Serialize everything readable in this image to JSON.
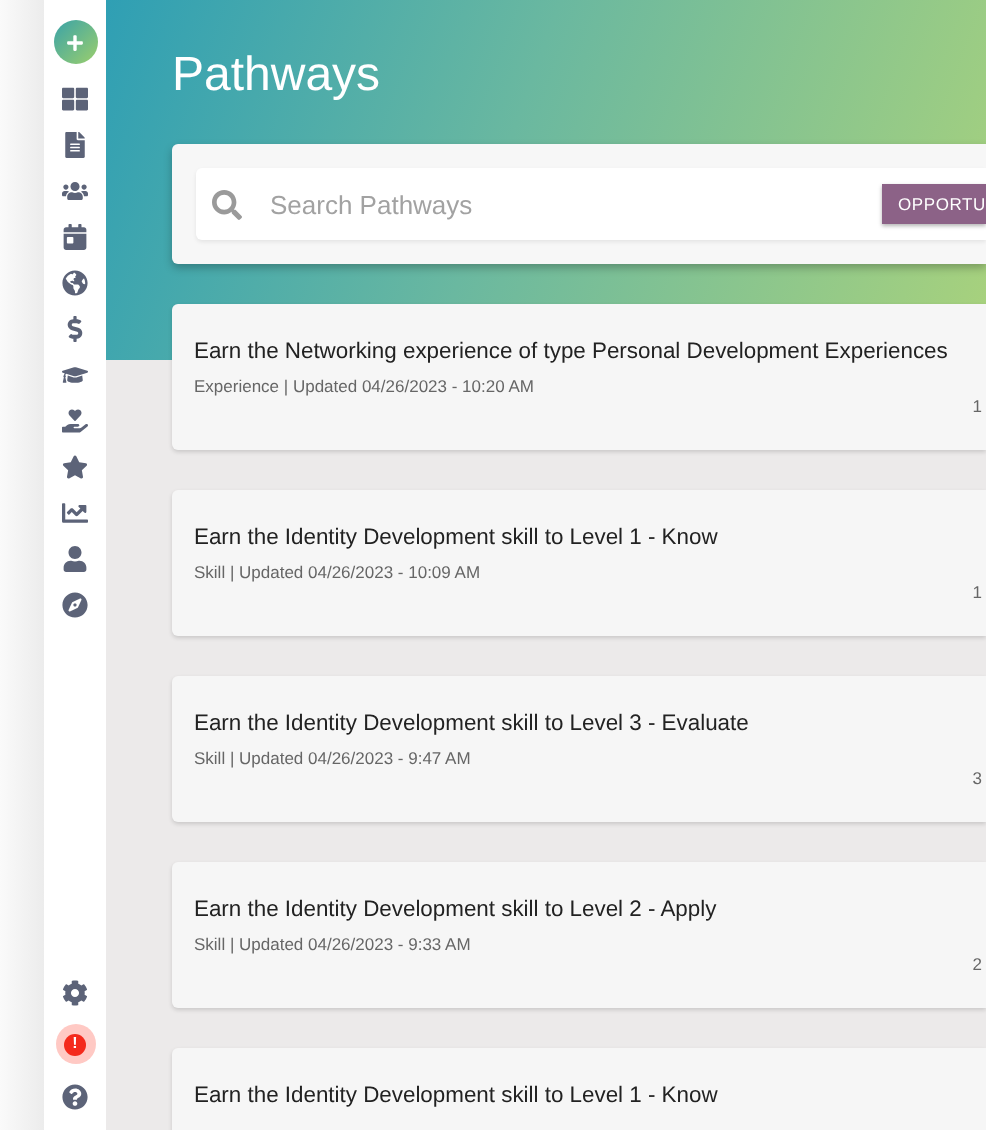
{
  "page": {
    "title": "Pathways"
  },
  "search": {
    "placeholder": "Search Pathways",
    "button": "OPPORTU"
  },
  "pathways": [
    {
      "title": "Earn the Networking experience of type Personal Development Experiences",
      "meta": "Experience | Updated 04/26/2023 - 10:20 AM",
      "count": "1"
    },
    {
      "title": "Earn the Identity Development skill to Level 1 - Know",
      "meta": "Skill | Updated 04/26/2023 - 10:09 AM",
      "count": "1"
    },
    {
      "title": "Earn the Identity Development skill to Level 3 - Evaluate",
      "meta": "Skill | Updated 04/26/2023 - 9:47 AM",
      "count": "3"
    },
    {
      "title": "Earn the Identity Development skill to Level 2 - Apply",
      "meta": "Skill | Updated 04/26/2023 - 9:33 AM",
      "count": "2"
    },
    {
      "title": "Earn the Identity Development skill to Level 1 - Know"
    }
  ],
  "sidebar": {
    "alert_badge": "!"
  }
}
